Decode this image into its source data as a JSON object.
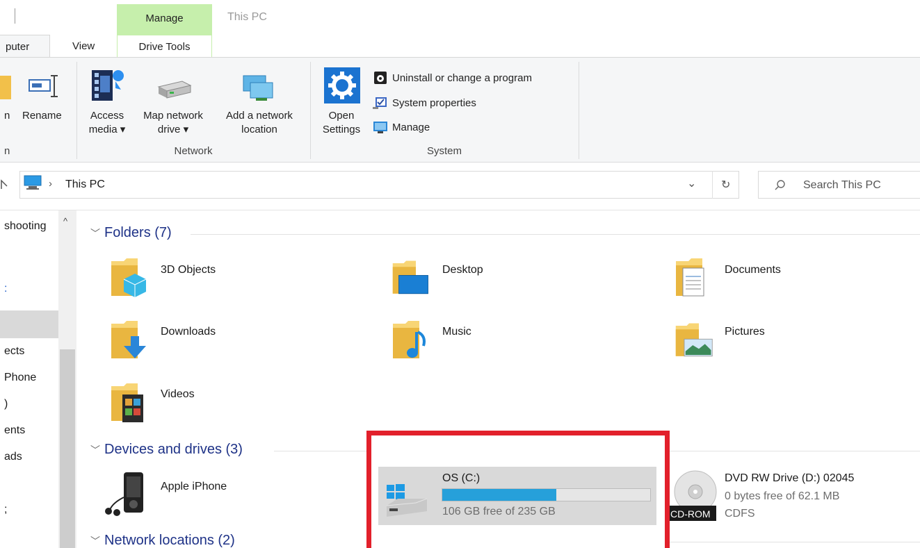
{
  "tabs": {
    "contextual_group": "Manage",
    "window_title": "This PC",
    "computer": "puter",
    "view": "View",
    "drive_tools": "Drive Tools"
  },
  "ribbon": {
    "partial_btn": "n",
    "rename": "Rename",
    "partial_group": "n",
    "access_media": [
      "Access",
      "media ▾"
    ],
    "map_network_drive": [
      "Map network",
      "drive ▾"
    ],
    "add_network_location": [
      "Add a network",
      "location"
    ],
    "network_group": "Network",
    "open_settings": [
      "Open",
      "Settings"
    ],
    "uninstall": "Uninstall or change a program",
    "system_properties": "System properties",
    "manage": "Manage",
    "system_group": "System"
  },
  "address": {
    "path": "This PC",
    "search_placeholder": "Search This PC"
  },
  "nav": {
    "items": [
      "shooting",
      ":",
      "ects",
      "Phone",
      ")",
      "ents",
      "ads",
      ";"
    ]
  },
  "folders": {
    "header": "Folders (7)",
    "items": [
      "3D Objects",
      "Desktop",
      "Documents",
      "Downloads",
      "Music",
      "Pictures",
      "Videos"
    ]
  },
  "devices": {
    "header": "Devices and drives (3)",
    "iphone": "Apple iPhone",
    "os_drive": {
      "name": "OS (C:)",
      "space": "106 GB free of 235 GB",
      "used_fraction": 0.55
    },
    "dvd": {
      "name": "DVD RW Drive (D:) 02045",
      "space": "0 bytes free of 62.1 MB",
      "fs": "CDFS",
      "badge": "CD-ROM"
    }
  },
  "network": {
    "header": "Network locations (2)"
  },
  "colors": {
    "accent_header": "#1e3287",
    "manage_context": "#c6efac",
    "drive_fill": "#26a0da",
    "highlight": "#e2202b"
  }
}
